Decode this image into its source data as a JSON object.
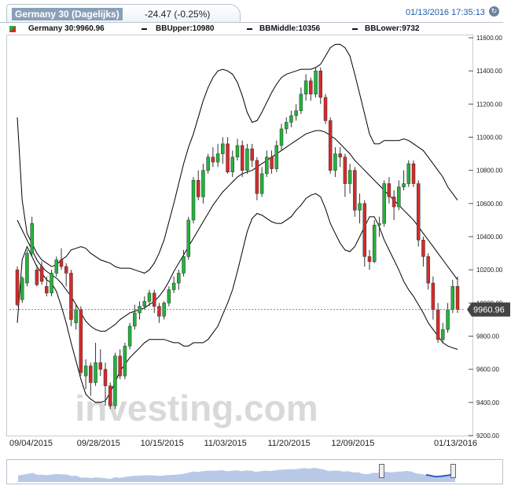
{
  "header": {
    "tab_title": "Germany 30 (Dagelijks)",
    "change": "-24.47 (-0.25%)",
    "timestamp": "01/13/2016  17:35:13",
    "refresh_icon": "refresh-icon"
  },
  "legend": {
    "instrument": "Germany 30:9960.96",
    "bb_upper": "BBUpper:10980",
    "bb_middle": "BBMiddle:10356",
    "bb_lower": "BBLower:9732"
  },
  "colors": {
    "up": "#22b33a",
    "down": "#d42b2b",
    "band": "#000000",
    "last": "#444444",
    "nav_fill": "#b8c9e8",
    "nav_sel": "#2d5fc4"
  },
  "watermark": "investing.com",
  "chart_data": {
    "type": "candlestick",
    "title": "Germany 30 (Dagelijks)",
    "ylim": [
      9200,
      11600
    ],
    "y_ticks": [
      "11600.00",
      "11400.00",
      "11200.00",
      "11000.00",
      "10800.00",
      "10600.00",
      "10400.00",
      "10200.00",
      "10000.00",
      "9800.00",
      "9600.00",
      "9400.00",
      "9200.00"
    ],
    "x_tick_labels": [
      "09/04/2015",
      "09/28/2015",
      "10/15/2015",
      "11/03/2015",
      "11/20/2015",
      "12/09/2015",
      "01/13/2016"
    ],
    "x_tick_index": [
      0,
      17,
      30,
      43,
      56,
      69,
      90
    ],
    "last_price": "9960.96",
    "candles": [
      [
        10200,
        9990,
        10220,
        9980
      ],
      [
        10020,
        10150,
        10160,
        10000
      ],
      [
        10120,
        10300,
        10320,
        10100
      ],
      [
        10300,
        10480,
        10520,
        10280
      ],
      [
        10200,
        10110,
        10230,
        10100
      ],
      [
        10220,
        10130,
        10250,
        10110
      ],
      [
        10100,
        10060,
        10160,
        10040
      ],
      [
        10060,
        10180,
        10200,
        10040
      ],
      [
        10180,
        10260,
        10280,
        10160
      ],
      [
        10260,
        10220,
        10330,
        10200
      ],
      [
        10220,
        10180,
        10240,
        10100
      ],
      [
        10180,
        9900,
        10200,
        9860
      ],
      [
        9880,
        9960,
        9990,
        9840
      ],
      [
        9960,
        9580,
        9980,
        9560
      ],
      [
        9560,
        9620,
        9660,
        9480
      ],
      [
        9620,
        9520,
        9640,
        9440
      ],
      [
        9520,
        9640,
        9760,
        9500
      ],
      [
        9640,
        9600,
        9720,
        9560
      ],
      [
        9600,
        9500,
        9640,
        9380
      ],
      [
        9500,
        9380,
        9520,
        9360
      ],
      [
        9380,
        9680,
        9700,
        9360
      ],
      [
        9680,
        9560,
        9720,
        9540
      ],
      [
        9560,
        9740,
        9760,
        9540
      ],
      [
        9740,
        9860,
        9880,
        9720
      ],
      [
        9860,
        9940,
        9990,
        9840
      ],
      [
        9940,
        9980,
        10010,
        9900
      ],
      [
        9980,
        10010,
        10040,
        9960
      ],
      [
        10010,
        10060,
        10080,
        9980
      ],
      [
        10060,
        9980,
        10080,
        9940
      ],
      [
        9980,
        9920,
        10000,
        9880
      ],
      [
        9920,
        10000,
        10010,
        9900
      ],
      [
        10000,
        10080,
        10100,
        9980
      ],
      [
        10080,
        10120,
        10160,
        10060
      ],
      [
        10120,
        10180,
        10200,
        10080
      ],
      [
        10180,
        10280,
        10320,
        10160
      ],
      [
        10280,
        10500,
        10520,
        10260
      ],
      [
        10500,
        10740,
        10760,
        10480
      ],
      [
        10740,
        10640,
        10800,
        10620
      ],
      [
        10640,
        10800,
        10840,
        10600
      ],
      [
        10800,
        10880,
        10900,
        10780
      ],
      [
        10880,
        10850,
        10940,
        10820
      ],
      [
        10850,
        10900,
        10960,
        10820
      ],
      [
        10900,
        10960,
        11000,
        10840
      ],
      [
        10960,
        10790,
        11000,
        10780
      ],
      [
        10790,
        10880,
        10920,
        10760
      ],
      [
        10880,
        10950,
        10990,
        10860
      ],
      [
        10950,
        10800,
        10980,
        10760
      ],
      [
        10800,
        10930,
        10960,
        10780
      ],
      [
        10930,
        10860,
        10960,
        10820
      ],
      [
        10860,
        10660,
        10880,
        10620
      ],
      [
        10660,
        10780,
        10820,
        10640
      ],
      [
        10780,
        10880,
        10920,
        10760
      ],
      [
        10880,
        10810,
        10920,
        10780
      ],
      [
        10810,
        10950,
        10980,
        10790
      ],
      [
        10950,
        11050,
        11080,
        10920
      ],
      [
        11050,
        11090,
        11120,
        11020
      ],
      [
        11090,
        11130,
        11160,
        11060
      ],
      [
        11130,
        11160,
        11200,
        11100
      ],
      [
        11160,
        11260,
        11300,
        11140
      ],
      [
        11260,
        11340,
        11380,
        11220
      ],
      [
        11340,
        11260,
        11360,
        11220
      ],
      [
        11260,
        11400,
        11420,
        11240
      ],
      [
        11400,
        11240,
        11420,
        11200
      ],
      [
        11240,
        11100,
        11260,
        11080
      ],
      [
        11100,
        10800,
        11120,
        10780
      ],
      [
        10800,
        10900,
        10940,
        10760
      ],
      [
        10900,
        10880,
        10940,
        10820
      ],
      [
        10880,
        10720,
        10900,
        10640
      ],
      [
        10720,
        10800,
        10840,
        10660
      ],
      [
        10800,
        10560,
        10820,
        10520
      ],
      [
        10560,
        10600,
        10660,
        10480
      ],
      [
        10600,
        10280,
        10620,
        10220
      ],
      [
        10280,
        10250,
        10320,
        10200
      ],
      [
        10250,
        10470,
        10500,
        10240
      ],
      [
        10470,
        10480,
        10520,
        10400
      ],
      [
        10480,
        10720,
        10740,
        10460
      ],
      [
        10720,
        10640,
        10760,
        10600
      ],
      [
        10640,
        10580,
        10680,
        10500
      ],
      [
        10580,
        10700,
        10740,
        10560
      ],
      [
        10700,
        10720,
        10800,
        10680
      ],
      [
        10720,
        10840,
        10860,
        10700
      ],
      [
        10840,
        10720,
        10860,
        10700
      ],
      [
        10720,
        10380,
        10740,
        10340
      ],
      [
        10380,
        10280,
        10400,
        10220
      ],
      [
        10280,
        10120,
        10300,
        10080
      ],
      [
        10120,
        9960,
        10160,
        9900
      ],
      [
        9960,
        9780,
        10000,
        9760
      ],
      [
        9780,
        9840,
        9880,
        9760
      ],
      [
        9840,
        9960,
        10000,
        9820
      ],
      [
        9960,
        10100,
        10140,
        9940
      ],
      [
        10100,
        9960,
        10160,
        9940
      ]
    ],
    "series": [
      {
        "name": "BBUpper",
        "values": [
          11120,
          10620,
          10420,
          10360,
          10300,
          10260,
          10240,
          10220,
          10230,
          10260,
          10280,
          10320,
          10330,
          10340,
          10330,
          10300,
          10280,
          10260,
          10250,
          10240,
          10220,
          10210,
          10210,
          10210,
          10200,
          10190,
          10180,
          10200,
          10240,
          10300,
          10380,
          10490,
          10600,
          10720,
          10840,
          10940,
          11020,
          11120,
          11220,
          11300,
          11360,
          11400,
          11410,
          11400,
          11380,
          11330,
          11250,
          11150,
          11090,
          11100,
          11150,
          11210,
          11270,
          11320,
          11360,
          11380,
          11390,
          11400,
          11410,
          11410,
          11410,
          11420,
          11440,
          11490,
          11540,
          11560,
          11560,
          11540,
          11490,
          11380,
          11260,
          11140,
          11020,
          10960,
          10960,
          10980,
          10980,
          10980,
          10980,
          10990,
          10980,
          10960,
          10940,
          10920,
          10880,
          10840,
          10800,
          10760,
          10700,
          10660,
          10620
        ]
      },
      {
        "name": "BBMiddle",
        "values": [
          10500,
          10440,
          10380,
          10320,
          10260,
          10220,
          10190,
          10170,
          10150,
          10120,
          10080,
          10040,
          9990,
          9940,
          9890,
          9860,
          9840,
          9830,
          9830,
          9850,
          9870,
          9900,
          9920,
          9940,
          9950,
          9960,
          9970,
          9990,
          10010,
          10040,
          10080,
          10130,
          10190,
          10240,
          10290,
          10340,
          10390,
          10440,
          10490,
          10540,
          10590,
          10630,
          10670,
          10700,
          10730,
          10760,
          10780,
          10790,
          10800,
          10820,
          10840,
          10860,
          10880,
          10900,
          10920,
          10940,
          10960,
          10980,
          11000,
          11020,
          11030,
          11040,
          11040,
          11030,
          11010,
          10990,
          10960,
          10930,
          10900,
          10860,
          10830,
          10800,
          10770,
          10740,
          10710,
          10680,
          10650,
          10620,
          10590,
          10560,
          10530,
          10500,
          10460,
          10420,
          10380,
          10340,
          10300,
          10260,
          10220,
          10180,
          10140
        ]
      },
      {
        "name": "BBLower",
        "values": [
          9880,
          10260,
          10340,
          10280,
          10220,
          10180,
          10140,
          10120,
          10070,
          9980,
          9880,
          9760,
          9650,
          9540,
          9450,
          9420,
          9400,
          9400,
          9410,
          9460,
          9520,
          9590,
          9630,
          9670,
          9700,
          9730,
          9760,
          9780,
          9780,
          9780,
          9780,
          9770,
          9760,
          9760,
          9740,
          9740,
          9760,
          9760,
          9760,
          9780,
          9820,
          9860,
          9930,
          10000,
          10080,
          10190,
          10310,
          10430,
          10510,
          10540,
          10530,
          10510,
          10490,
          10480,
          10480,
          10500,
          10520,
          10560,
          10590,
          10630,
          10650,
          10660,
          10640,
          10570,
          10480,
          10420,
          10360,
          10320,
          10310,
          10340,
          10400,
          10460,
          10520,
          10520,
          10460,
          10380,
          10320,
          10260,
          10200,
          10130,
          10080,
          10040,
          9990,
          9940,
          9880,
          9840,
          9800,
          9760,
          9740,
          9730,
          9720
        ]
      }
    ]
  }
}
